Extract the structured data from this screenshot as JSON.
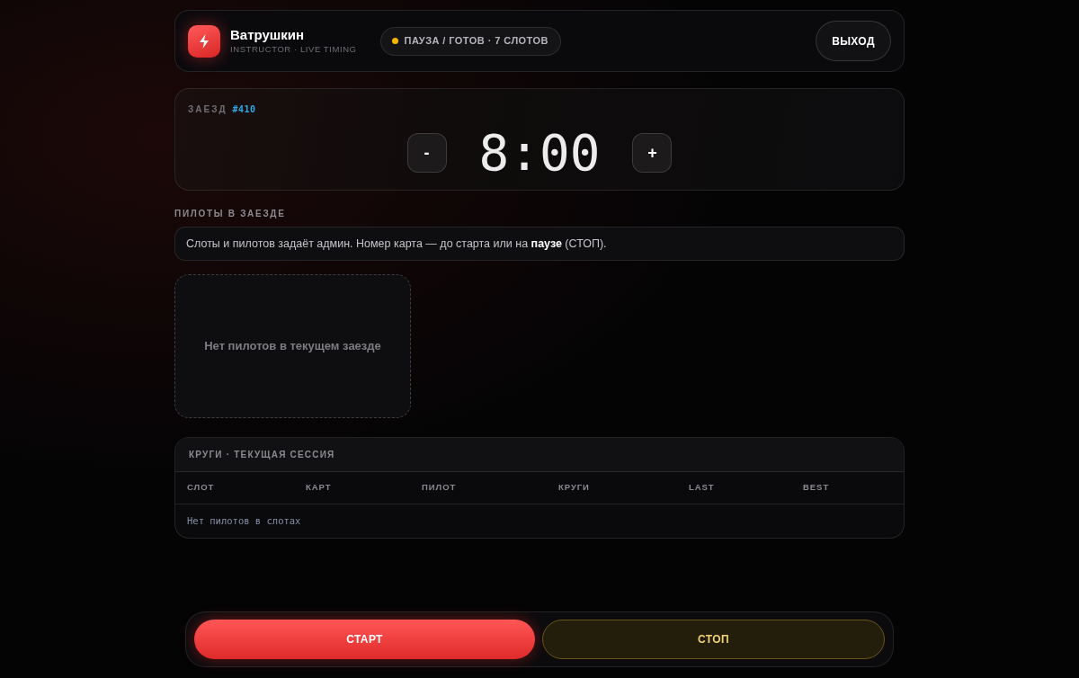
{
  "header": {
    "brand": {
      "name": "Ватрушкин",
      "subtitle": "INSTRUCTOR · LIVE TIMING"
    },
    "status": "ПАУЗА / ГОТОВ · 7 СЛОТОВ",
    "logout_button": "ВЫХОД"
  },
  "heat": {
    "label": "ЗАЕЗД",
    "number": "#410",
    "decrement_button": "-",
    "time": "8:00",
    "increment_button": "+"
  },
  "pilots": {
    "title": "ПИЛОТЫ В ЗАЕЗДЕ",
    "notice": "Слоты и пилотов задаёт админ. Номер карта — до старта или на **паузе** (СТОП).",
    "empty_text": "Нет пилотов в текущем заезде"
  },
  "laps": {
    "title": "КРУГИ · ТЕКУЩАЯ СЕССИЯ",
    "columns": [
      "СЛОТ",
      "КАРТ",
      "ПИЛОТ",
      "КРУГИ",
      "LAST",
      "BEST"
    ],
    "empty_text": "Нет пилотов в слотах"
  },
  "controls": {
    "start_button": "СТАРТ",
    "stop_button": "СТОП"
  }
}
